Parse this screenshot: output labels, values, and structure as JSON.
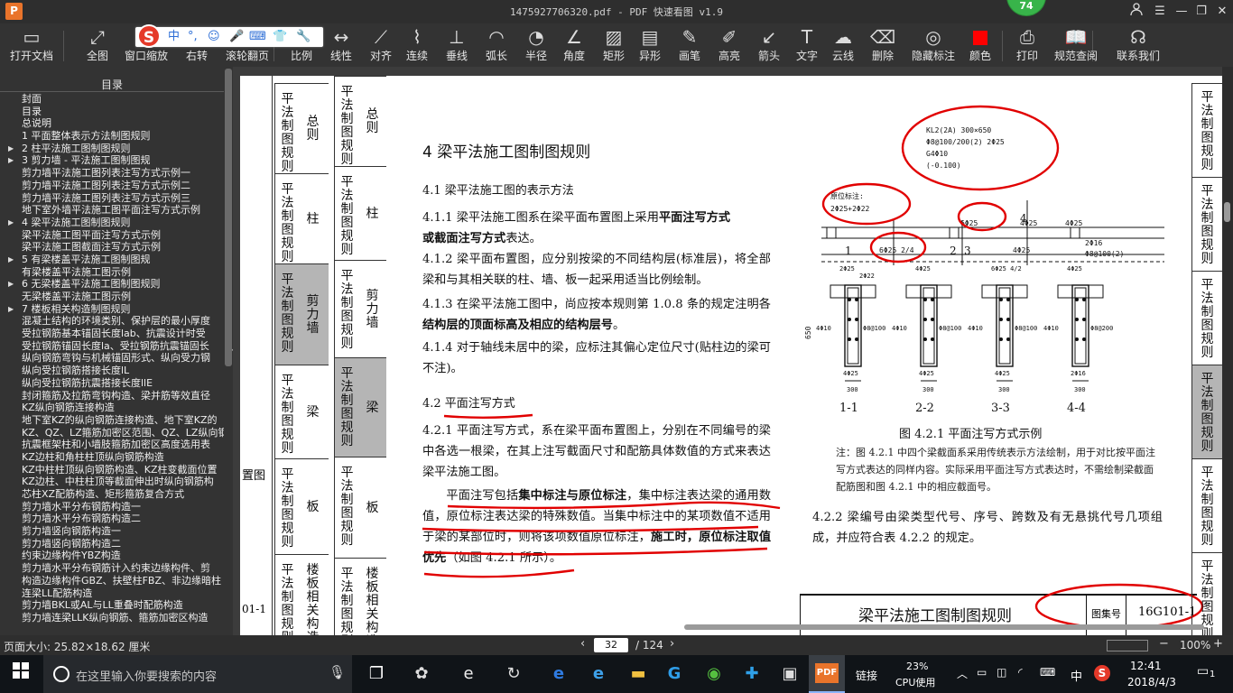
{
  "window": {
    "title": "1475927706320.pdf - PDF 快速看图 v1.9",
    "app_logo": "P",
    "cpu_badge": "74"
  },
  "toolbar": {
    "items": [
      "打开文档",
      "全图",
      "窗口缩放",
      "右转",
      "滚轮翻页",
      "比例",
      "线性",
      "对齐",
      "连续",
      "垂线",
      "弧长",
      "半径",
      "角度",
      "矩形",
      "异形",
      "画笔",
      "高亮",
      "箭头",
      "文字",
      "云线",
      "删除",
      "隐藏标注",
      "颜色",
      "打印",
      "规范查阅",
      "联系我们"
    ],
    "ime": {
      "logo": "S",
      "items": [
        "中",
        "°,",
        "☺",
        "🎤",
        "⌨",
        "👕",
        "🔧"
      ]
    }
  },
  "sidebar": {
    "title": "目录",
    "toc": [
      {
        "label": "封面",
        "indent": 1,
        "arrow": false
      },
      {
        "label": "目录",
        "indent": 1,
        "arrow": false
      },
      {
        "label": "总说明",
        "indent": 1,
        "arrow": false
      },
      {
        "label": "1 平面整体表示方法制图规则",
        "indent": 1,
        "arrow": false
      },
      {
        "label": "2 柱平法施工图制图规则",
        "indent": 1,
        "arrow": true
      },
      {
        "label": "3 剪力墙 - 平法施工图制图规",
        "indent": 1,
        "arrow": true
      },
      {
        "label": "剪力墙平法施工图列表注写方式示例一",
        "indent": 2,
        "arrow": false
      },
      {
        "label": "剪力墙平法施工图列表注写方式示例二",
        "indent": 2,
        "arrow": false
      },
      {
        "label": "剪力墙平法施工图列表注写方式示例三",
        "indent": 2,
        "arrow": false
      },
      {
        "label": "地下室外墙平法施工图平面注写方式示例",
        "indent": 2,
        "arrow": false
      },
      {
        "label": "4 梁平法施工图制图规则",
        "indent": 1,
        "arrow": true
      },
      {
        "label": "梁平法施工图平面注写方式示例",
        "indent": 2,
        "arrow": false
      },
      {
        "label": "梁平法施工图截面注写方式示例",
        "indent": 2,
        "arrow": false
      },
      {
        "label": "5 有梁楼盖平法施工图制图规",
        "indent": 1,
        "arrow": true
      },
      {
        "label": "有梁楼盖平法施工图示例",
        "indent": 2,
        "arrow": false
      },
      {
        "label": "6 无梁楼盖平法施工图制图规则",
        "indent": 1,
        "arrow": true
      },
      {
        "label": "无梁楼盖平法施工图示例",
        "indent": 2,
        "arrow": false
      },
      {
        "label": "7 楼板相关构造制图规则",
        "indent": 1,
        "arrow": true
      },
      {
        "label": "混凝土结构的环境类别、保护层的最小厚度",
        "indent": 2,
        "arrow": false
      },
      {
        "label": "受拉钢筋基本锚固长度lab、抗震设计时受",
        "indent": 2,
        "arrow": false
      },
      {
        "label": "受拉钢筋锚固长度la、受拉钢筋抗震锚固长",
        "indent": 2,
        "arrow": false
      },
      {
        "label": "纵向钢筋弯钩与机械锚固形式、纵向受力钢",
        "indent": 2,
        "arrow": false
      },
      {
        "label": "纵向受拉钢筋搭接长度lL",
        "indent": 2,
        "arrow": false
      },
      {
        "label": "纵向受拉钢筋抗震搭接长度llE",
        "indent": 2,
        "arrow": false
      },
      {
        "label": "封闭箍筋及拉筋弯钩构造、梁并筋等效直径",
        "indent": 2,
        "arrow": false
      },
      {
        "label": "KZ纵向钢筋连接构造",
        "indent": 2,
        "arrow": false
      },
      {
        "label": "地下室KZ的纵向钢筋连接构造、地下室KZ的",
        "indent": 2,
        "arrow": false
      },
      {
        "label": "KZ、QZ、LZ箍筋加密区范围、QZ、LZ纵向钢",
        "indent": 2,
        "arrow": false
      },
      {
        "label": "抗震框架柱和小墙肢箍筋加密区高度选用表",
        "indent": 2,
        "arrow": false
      },
      {
        "label": "KZ边柱和角柱柱顶纵向钢筋构造",
        "indent": 2,
        "arrow": false
      },
      {
        "label": "KZ中柱柱顶纵向钢筋构造、KZ柱变截面位置",
        "indent": 2,
        "arrow": false
      },
      {
        "label": "KZ边柱、中柱柱顶等截面伸出时纵向钢筋构",
        "indent": 2,
        "arrow": false
      },
      {
        "label": "芯柱XZ配筋构造、矩形箍筋复合方式",
        "indent": 2,
        "arrow": false
      },
      {
        "label": "剪力墙水平分布钢筋构造一",
        "indent": 2,
        "arrow": false
      },
      {
        "label": "剪力墙水平分布钢筋构造二",
        "indent": 2,
        "arrow": false
      },
      {
        "label": "剪力墙竖向钢筋构造一",
        "indent": 2,
        "arrow": false
      },
      {
        "label": "剪力墙竖向钢筋构造二",
        "indent": 2,
        "arrow": false
      },
      {
        "label": "约束边缘构件YBZ构造",
        "indent": 2,
        "arrow": false
      },
      {
        "label": "剪力墙水平分布钢筋计入约束边缘构件、剪",
        "indent": 2,
        "arrow": false
      },
      {
        "label": "构造边缘构件GBZ、扶壁柱FBZ、非边缘暗柱",
        "indent": 2,
        "arrow": false
      },
      {
        "label": "连梁LL配筋构造",
        "indent": 2,
        "arrow": false
      },
      {
        "label": "剪力墙BKL或AL与LL重叠时配筋构造",
        "indent": 2,
        "arrow": false
      },
      {
        "label": "剪力墙连梁LLK纵向钢筋、箍筋加密区构造",
        "indent": 2,
        "arrow": false
      }
    ]
  },
  "document": {
    "left_page": {
      "partial_label": "置图",
      "partial_footer": "01-1",
      "tabs": [
        {
          "main": "平法制图规则",
          "side": "总则",
          "gray": false
        },
        {
          "main": "平法制图规则",
          "side": "柱",
          "gray": false
        },
        {
          "main": "平法制图规则",
          "side": "剪力墙",
          "gray": true
        },
        {
          "main": "平法制图规则",
          "side": "梁",
          "gray": false
        },
        {
          "main": "平法制图规则",
          "side": "板",
          "gray": false
        },
        {
          "main": "平法制图规则",
          "side": "楼板相关构造",
          "gray": false
        }
      ]
    },
    "right_tabs": [
      {
        "main": "平法制图规则",
        "side": "总则",
        "gray": false
      },
      {
        "main": "平法制图规则",
        "side": "柱",
        "gray": false
      },
      {
        "main": "平法制图规则",
        "side": "剪力墙",
        "gray": false
      },
      {
        "main": "平法制图规则",
        "side": "梁",
        "gray": true
      },
      {
        "main": "平法制图规则",
        "side": "板",
        "gray": false
      },
      {
        "main": "平法制图规则",
        "side": "楼板相关构造",
        "gray": false
      }
    ],
    "edge_tabs": [
      "平法制图规则",
      "平法制图规则",
      "平法制图规则",
      "平法制图规则",
      "平法制图规则",
      "平法制图规则"
    ],
    "heading": "4  梁平法施工图制图规则",
    "sec_4_1": "4.1 梁平法施工图的表示方法",
    "p_4_1_1a": "4.1.1 梁平法施工图系在梁平面布置图上采用",
    "p_4_1_1b": "平面注写方式",
    "p_4_1_1c": "或截面注写方式",
    "p_4_1_1d": "表达。",
    "p_4_1_2": "4.1.2 梁平面布置图，应分别按梁的不同结构层(标准层)，将全部梁和与其相关联的柱、墙、板一起采用适当比例绘制。",
    "p_4_1_3a": "4.1.3 在梁平法施工图中，尚应按本规则第 1.0.8 条的规定注明各",
    "p_4_1_3b": "结构层的顶面标高及相应的结构层号",
    "p_4_1_3c": "。",
    "p_4_1_4": "4.1.4 对于轴线未居中的梁，应标注其偏心定位尺寸(贴柱边的梁可不注)。",
    "sec_4_2": "4.2 平面注写方式",
    "p_4_2_1": "4.2.1 平面注写方式，系在梁平面布置图上，分别在不同编号的梁中各选一根梁，在其上注写截面尺寸和配筋具体数值的方式来表达梁平法施工图。",
    "p_4_2_1b_1": "平面注写包括",
    "p_4_2_1b_2": "集中标注与原位标注",
    "p_4_2_1b_3": "，集中标注表达梁的通用数值，原位标注表达梁的特殊数值。当集中标注中的某项数值不适用于梁的某部位时，则将该项数值原位标注，",
    "p_4_2_1b_4": "施工时，原位标注取值优先",
    "p_4_2_1b_5": "（如图 4.2.1 所示）。",
    "figure": {
      "kl_label": [
        "KL2(2A)  300×650",
        "Φ8@100/200(2)  2Φ25",
        "G4Φ10",
        "(-0.100)"
      ],
      "orig_label": "原位标注:",
      "orig_value": "2Φ25+2Φ22",
      "bar_6_25": "6Φ25",
      "bar_4_25": "4Φ25",
      "bar_6_25_24": "6Φ25  2/4",
      "bar_2_16": "2Φ16",
      "bar_2_16_sub": "Φ8@100(2)",
      "axis_nums": [
        "1",
        "2",
        "3",
        "4"
      ],
      "dim_650": "650",
      "dim_300": "300",
      "sections": [
        "1-1",
        "2-2",
        "3-3",
        "4-4"
      ],
      "sec_labels": [
        {
          "top": "2Φ25",
          "top2": "2Φ22",
          "left": "4Φ10",
          "right": "Φ8@100",
          "bottom": "4Φ25"
        },
        {
          "top": "4Φ25",
          "top2": "",
          "left": "4Φ10",
          "right": "Φ8@100",
          "bottom": "4Φ25"
        },
        {
          "top": "6Φ25 4/2",
          "top2": "",
          "left": "4Φ10",
          "right": "Φ8@100",
          "bottom": "4Φ25"
        },
        {
          "top": "4Φ25",
          "top2": "",
          "left": "4Φ10",
          "right": "Φ8@200",
          "bottom": "2Φ16"
        }
      ],
      "title": "图 4.2.1  平面注写方式示例",
      "note": "注：图 4.2.1 中四个梁截面系采用传统表示方法绘制，用于对比按平面注写方式表达的同样内容。实际采用平面注写方式表达时，不需绘制梁截面配筋图和图 4.2.1 中的相应截面号。"
    },
    "p_4_2_2": "4.2.2 梁编号由梁类型代号、序号、跨数及有无悬挑代号几项组成，并应符合表 4.2.2 的规定。",
    "footer_title": "梁平法施工图制图规则",
    "atlas_label": "图集号",
    "atlas_no": "16G101-1"
  },
  "statusbar": {
    "page_size": "页面大小: 25.82×18.62 厘米",
    "page_current": "32",
    "page_total": "/ 124",
    "zoom": "100%"
  },
  "taskbar": {
    "search_placeholder": "在这里输入你要搜索的内容",
    "link_label": "链接",
    "cpu_percent": "23%",
    "cpu_label": "CPU使用",
    "ime": "中",
    "time": "12:41",
    "date": "2018/4/3",
    "notifications": "1"
  },
  "colors": {
    "annotation": "#e10000",
    "toolbar_bg": "#333333",
    "page_bg": "#ffffff",
    "gray_tab": "#b5b5b5"
  }
}
